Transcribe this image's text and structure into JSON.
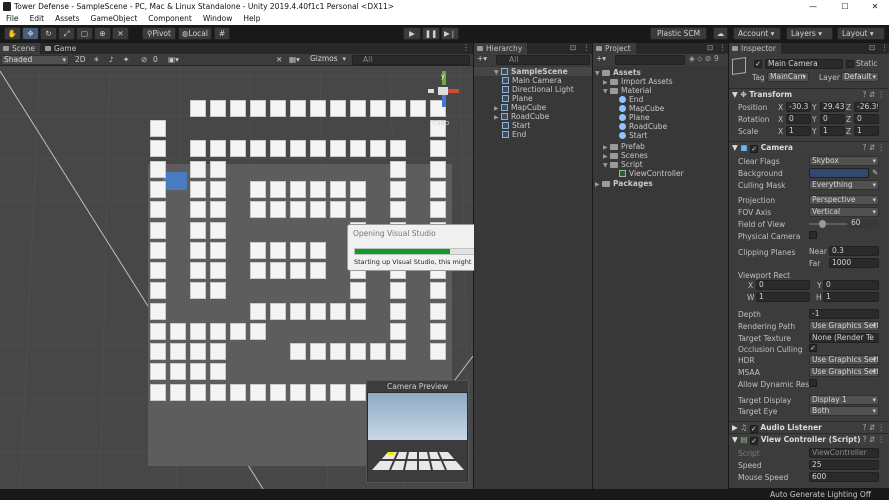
{
  "window": {
    "title": "Tower Defense - SampleScene - PC, Mac & Linux Standalone - Unity 2019.4.40f1c1 Personal <DX11>",
    "min": "—",
    "max": "☐",
    "close": "✕"
  },
  "menu": [
    "File",
    "Edit",
    "Assets",
    "GameObject",
    "Component",
    "Window",
    "Help"
  ],
  "toolbar": {
    "pivot": "Pivot",
    "local": "Local",
    "plastic": "Plastic SCM",
    "account": "Account",
    "layers": "Layers",
    "layout": "Layout"
  },
  "scene": {
    "tab_scene": "Scene",
    "tab_game": "Game",
    "shading": "Shaded",
    "mode2d": "2D",
    "fx_count": "0",
    "gizmos": "Gizmos",
    "search_all": "All",
    "gizmo_axis_y": "y",
    "gizmo_axis_z": "z",
    "gizmo_top": "Top",
    "camera_preview_title": "Camera Preview"
  },
  "dialog": {
    "title": "Opening Visual Studio",
    "message": "Starting up Visual Studio, this might take some time.",
    "progress": 0.53
  },
  "hierarchy": {
    "tab": "Hierarchy",
    "search_all": "All",
    "scene_name": "SampleScene",
    "items": [
      "Main Camera",
      "Directional Light",
      "Plane",
      "MapCube",
      "RoadCube",
      "Start",
      "End"
    ]
  },
  "project": {
    "tab": "Project",
    "hidden_count": "9",
    "assets": "Assets",
    "import_assets": "Import Assets",
    "material_folder": "Material",
    "materials": [
      "End",
      "MapCube",
      "Plane",
      "RoadCube",
      "Start"
    ],
    "prefab": "Prefab",
    "scenes": "Scenes",
    "script": "Script",
    "script_file": "ViewController",
    "packages": "Packages"
  },
  "inspector": {
    "tab": "Inspector",
    "object_name": "Main Camera",
    "static_label": "Static",
    "tag_label": "Tag",
    "tag_value": "MainCam",
    "layer_label": "Layer",
    "layer_value": "Default",
    "transform": {
      "header": "Transform",
      "position_label": "Position",
      "rotation_label": "Rotation",
      "scale_label": "Scale",
      "axis_x": "X",
      "axis_y": "Y",
      "axis_z": "Z",
      "position": [
        "-30.3",
        "29.43",
        "-26.39"
      ],
      "rotation": [
        "0",
        "0",
        "0"
      ],
      "scale": [
        "1",
        "1",
        "1"
      ]
    },
    "camera": {
      "header": "Camera",
      "rows": [
        {
          "label": "Clear Flags",
          "value": "Skybox"
        },
        {
          "label": "Background",
          "value": ""
        },
        {
          "label": "Culling Mask",
          "value": "Everything"
        },
        {
          "label": "Projection",
          "value": "Perspective"
        },
        {
          "label": "FOV Axis",
          "value": "Vertical"
        },
        {
          "label": "Field of View",
          "value": "60"
        },
        {
          "label": "Physical Camera",
          "value": ""
        },
        {
          "label": "Clipping Planes",
          "value": ""
        },
        {
          "label": "Viewport Rect",
          "value": ""
        },
        {
          "label": "Depth",
          "value": "-1"
        },
        {
          "label": "Rendering Path",
          "value": "Use Graphics Sett"
        },
        {
          "label": "Target Texture",
          "value": "None (Render Te"
        },
        {
          "label": "Occlusion Culling",
          "value": "✓"
        },
        {
          "label": "HDR",
          "value": "Use Graphics Sett"
        },
        {
          "label": "MSAA",
          "value": "Use Graphics Sett"
        },
        {
          "label": "Allow Dynamic Reso",
          "value": ""
        },
        {
          "label": "Target Display",
          "value": "Display 1"
        },
        {
          "label": "Target Eye",
          "value": "Both"
        }
      ],
      "near_label": "Near",
      "near": "0.3",
      "far_label": "Far",
      "far": "1000",
      "vp_x_label": "X",
      "vp_x": "0",
      "vp_y_label": "Y",
      "vp_y": "0",
      "vp_w_label": "W",
      "vp_w": "1",
      "vp_h_label": "H",
      "vp_h": "1",
      "background_color": "#31486f"
    },
    "audio_listener": "Audio Listener",
    "view_controller": {
      "header": "View Controller (Script)",
      "script_label": "Script",
      "script_value": "ViewController",
      "speed_label": "Speed",
      "speed": "25",
      "mouse_label": "Mouse Speed",
      "mouse_speed": "600"
    }
  },
  "status": {
    "right": "Auto Generate Lighting Off"
  }
}
